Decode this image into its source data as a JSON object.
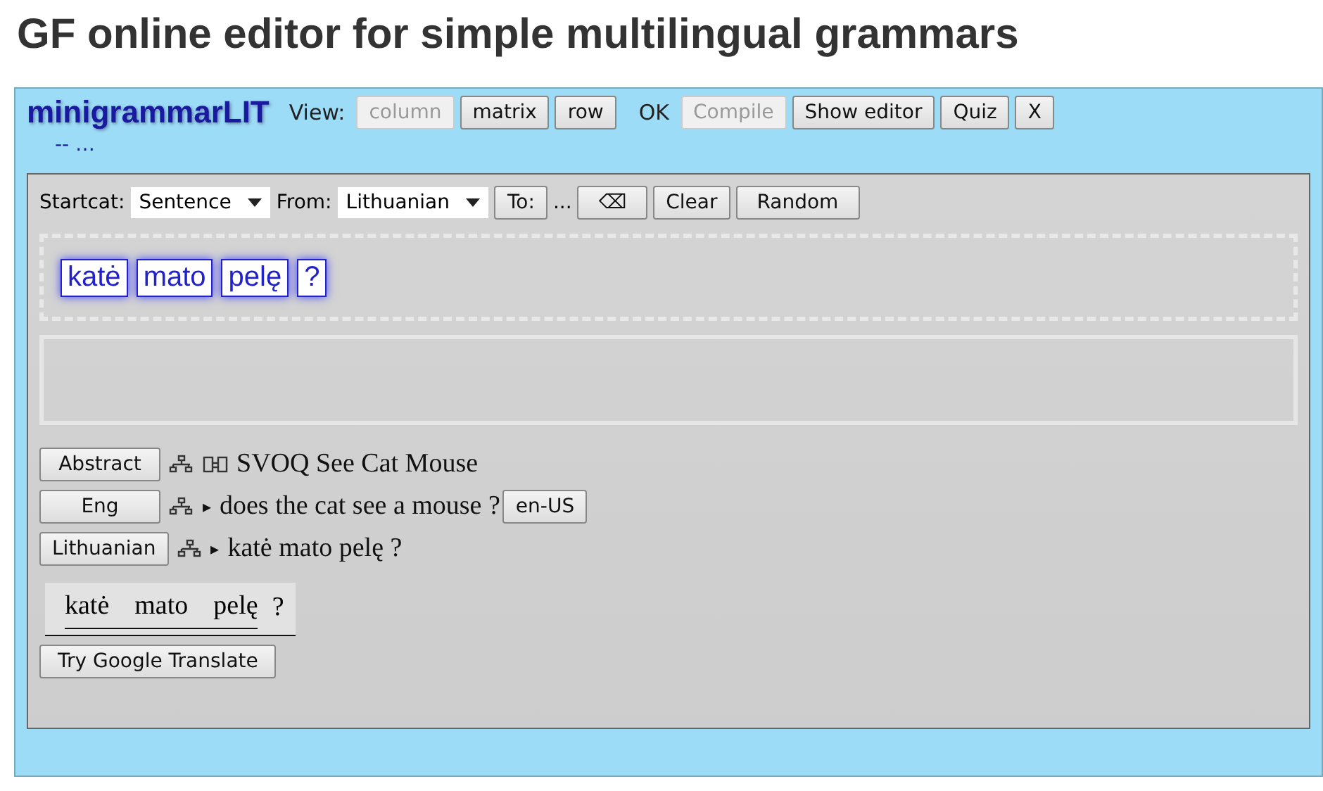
{
  "page_title": "GF online editor for simple multilingual grammars",
  "toolbar": {
    "grammar": "minigrammarLIT",
    "view_label": "View:",
    "view_buttons": [
      {
        "label": "column",
        "disabled": true
      },
      {
        "label": "matrix",
        "disabled": false
      },
      {
        "label": "row",
        "disabled": false
      }
    ],
    "status": "OK",
    "buttons": [
      {
        "label": "Compile",
        "disabled": true
      },
      {
        "label": "Show editor",
        "disabled": false
      },
      {
        "label": "Quiz",
        "disabled": false
      },
      {
        "label": "X",
        "disabled": false
      }
    ],
    "subline": "-- …"
  },
  "controls": {
    "startcat_label": "Startcat:",
    "startcat": "Sentence",
    "from_label": "From:",
    "from": "Lithuanian",
    "to_button": "To:",
    "ellipsis": "...",
    "backspace": "⌫",
    "clear": "Clear",
    "random": "Random"
  },
  "words": [
    "katė",
    "mato",
    "pelę",
    "?"
  ],
  "rows": [
    {
      "kind": "abstract",
      "button": "Abstract",
      "text": "SVOQ See Cat Mouse"
    },
    {
      "kind": "concrete",
      "button": "Eng",
      "marker": "▸",
      "text": "does the cat see a mouse ?",
      "lang_button": "en-US"
    },
    {
      "kind": "concrete",
      "button": "Lithuanian",
      "marker": "▸",
      "text": "katė mato pelę ?"
    }
  ],
  "alignment": {
    "phrase": [
      "katė",
      "mato",
      "pelę"
    ],
    "tail": "?"
  },
  "translate_button": "Try Google Translate"
}
